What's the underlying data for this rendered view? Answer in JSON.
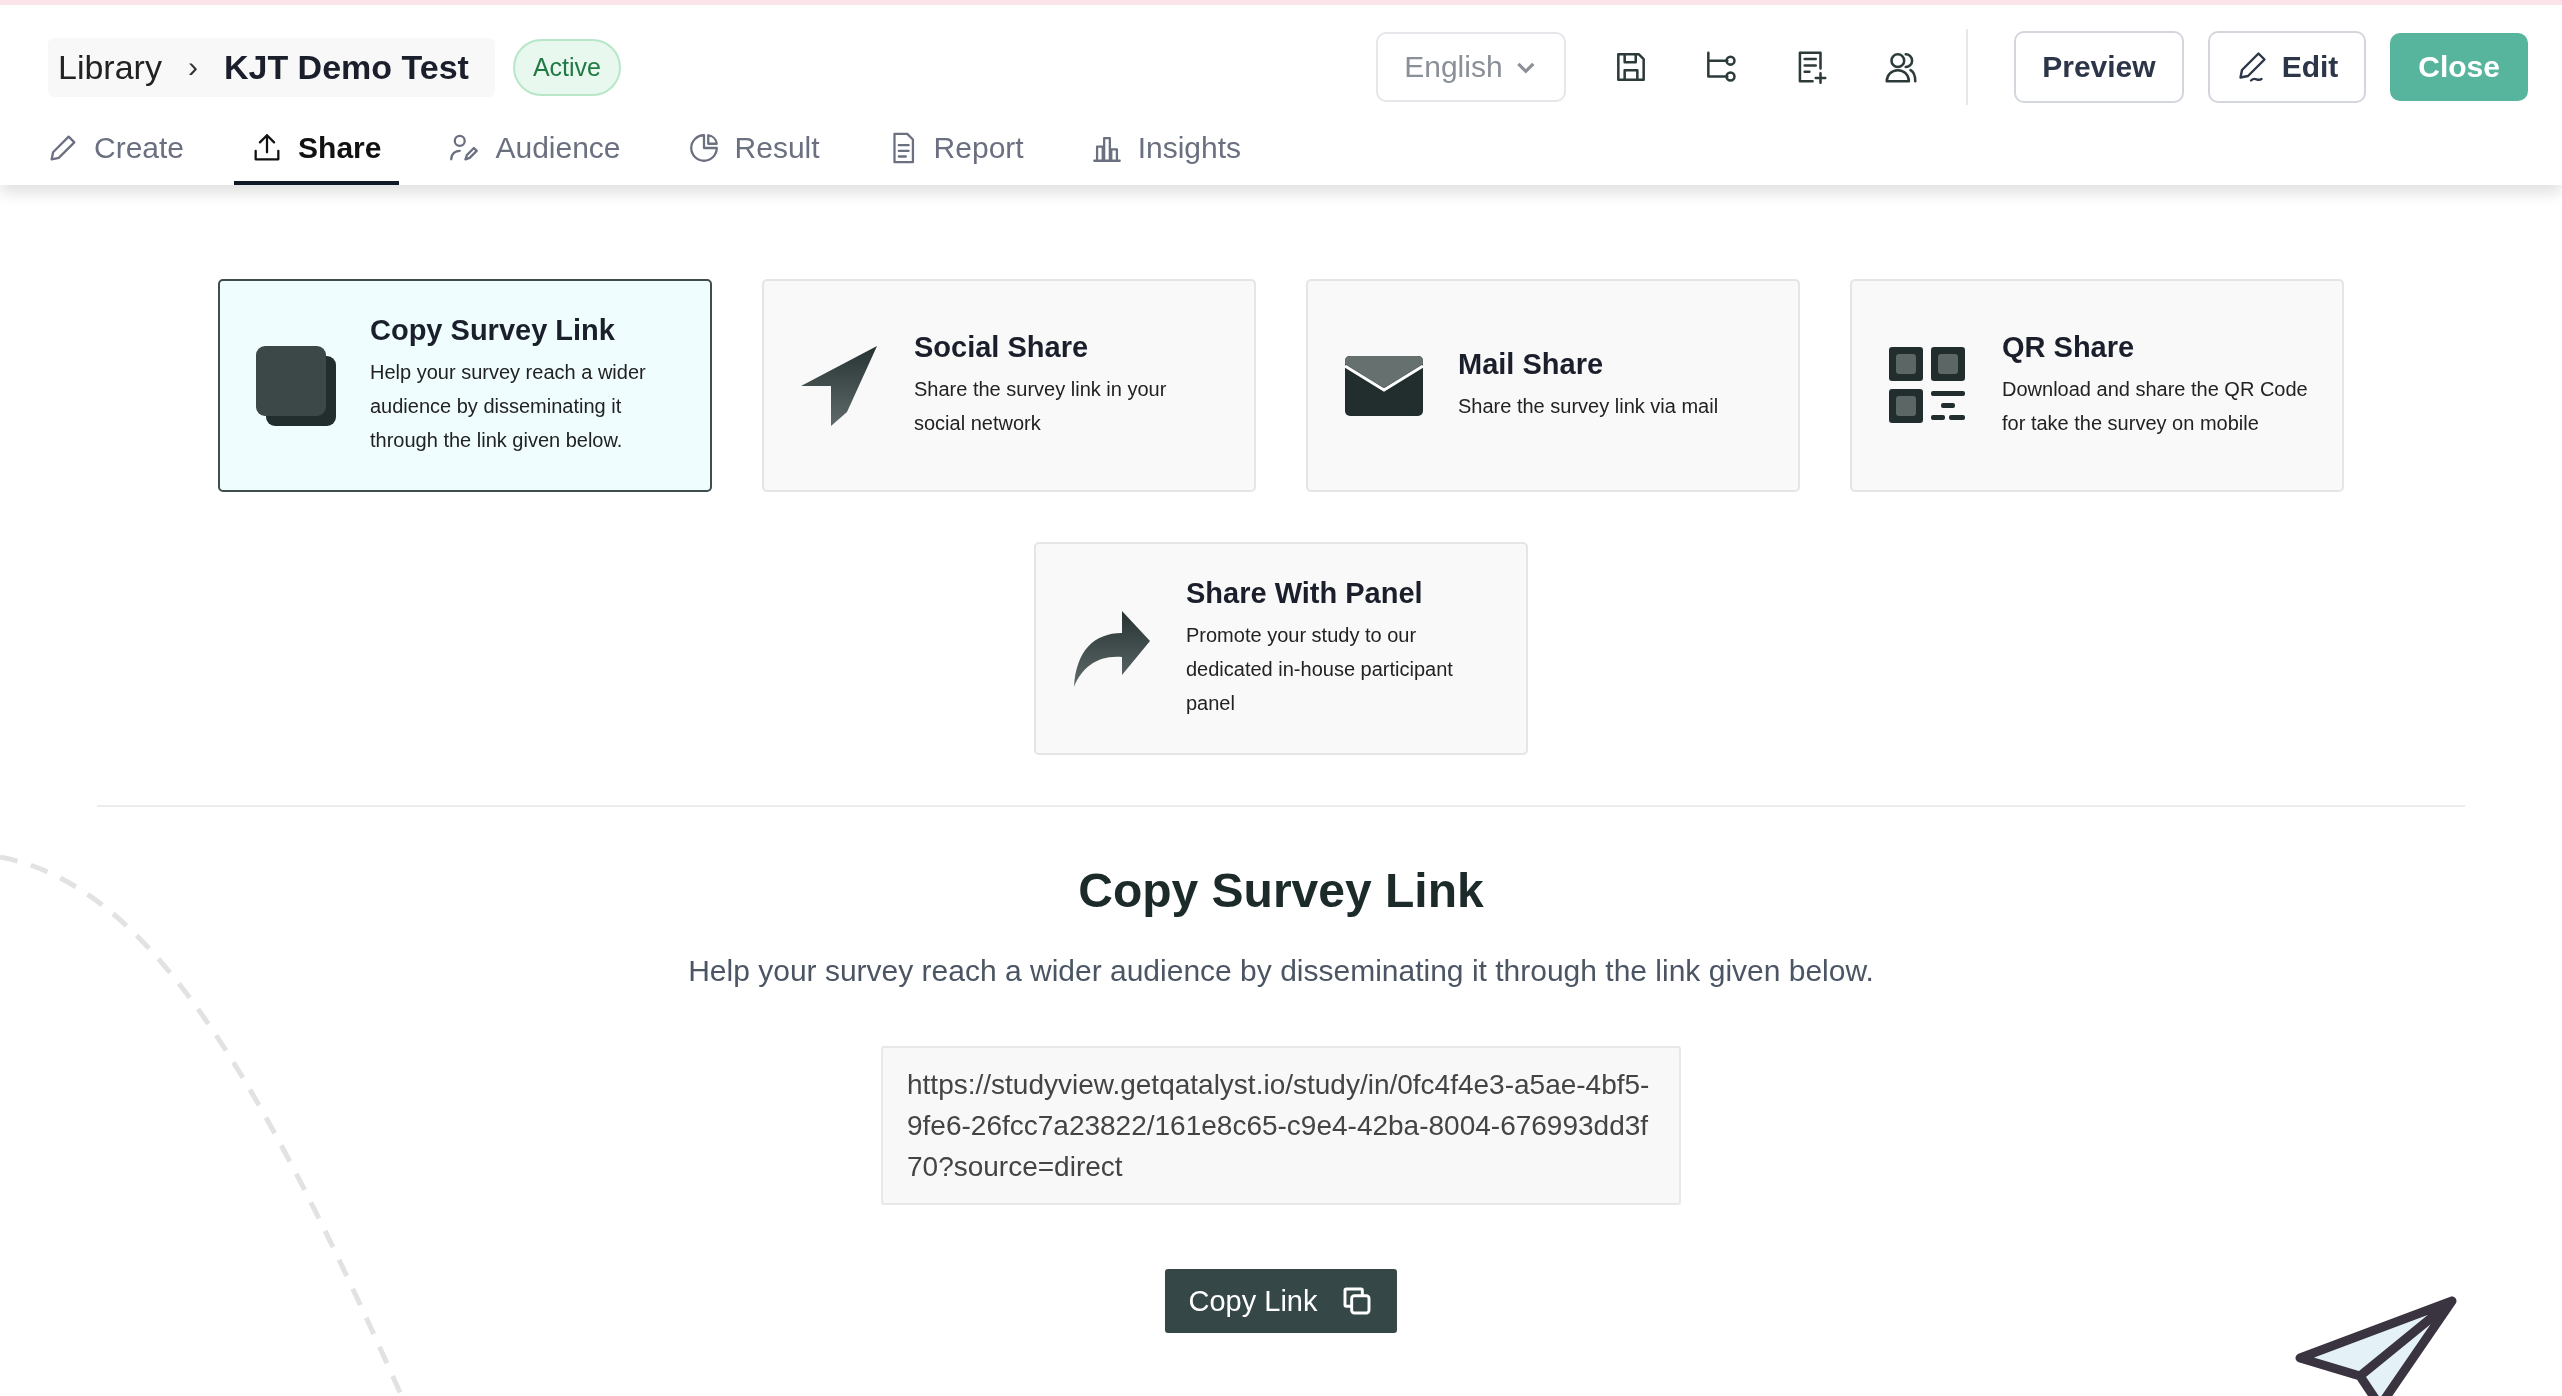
{
  "breadcrumb": {
    "parent": "Library",
    "separator": "›",
    "current": "KJT Demo Test"
  },
  "status_badge": "Active",
  "language": {
    "value": "English"
  },
  "actions": [
    {
      "label": "Preview",
      "kind": "outline"
    },
    {
      "label": "Edit",
      "kind": "outline-icon"
    },
    {
      "label": "Close",
      "kind": "primary"
    }
  ],
  "tabs": [
    {
      "label": "Create",
      "selected": false
    },
    {
      "label": "Share",
      "selected": true
    },
    {
      "label": "Audience",
      "selected": false
    },
    {
      "label": "Result",
      "selected": false
    },
    {
      "label": "Report",
      "selected": false
    },
    {
      "label": "Insights",
      "selected": false
    }
  ],
  "share_options": [
    {
      "title": "Copy Survey Link",
      "description": "Help your survey reach a wider audience by disseminating it through the link given below.",
      "selected": true
    },
    {
      "title": "Social Share",
      "description": "Share the survey link in your social network",
      "selected": false
    },
    {
      "title": "Mail Share",
      "description": "Share the survey link via mail",
      "selected": false
    },
    {
      "title": "QR Share",
      "description": "Download and share the QR Code for take the survey on mobile",
      "selected": false
    },
    {
      "title": "Share With Panel",
      "description": "Promote your study to our dedicated in-house participant panel",
      "selected": false
    }
  ],
  "detail": {
    "title": "Copy Survey Link",
    "description": "Help your survey reach a wider audience by disseminating it through the link given below.",
    "link": "https://studyview.getqatalyst.io/study/in/0fc4f4e3-a5ae-4bf5-9fe6-26fcc7a23822/161e8c65-c9e4-42ba-8004-676993dd3f70?source=direct",
    "button": "Copy Link"
  }
}
